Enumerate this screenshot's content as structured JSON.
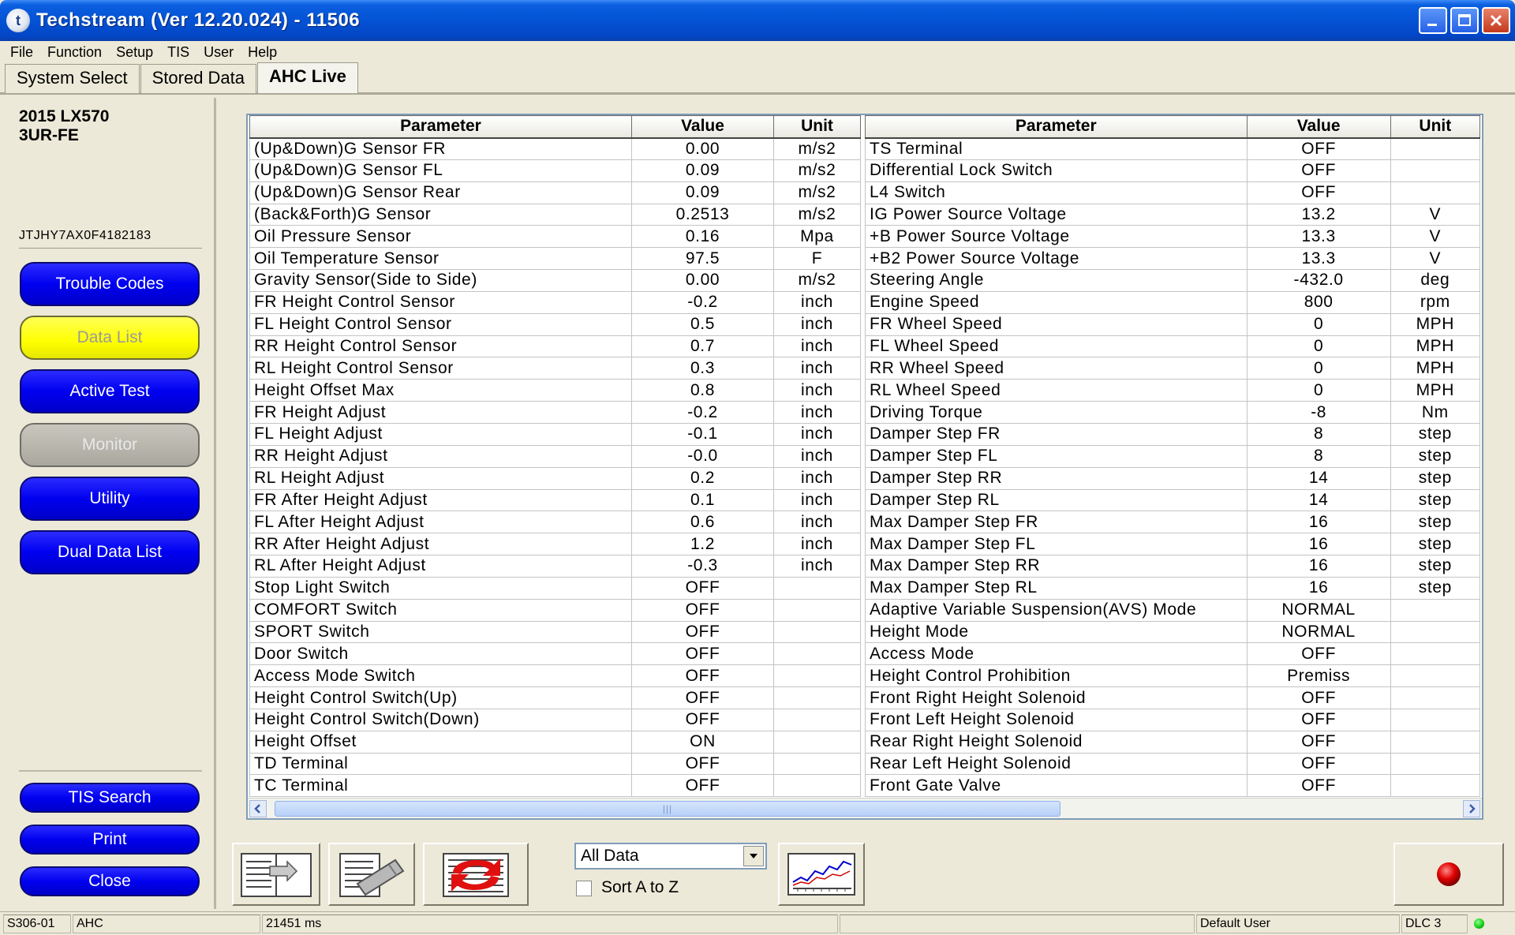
{
  "window": {
    "title": "Techstream (Ver 12.20.024) - 11506"
  },
  "menu": [
    "File",
    "Function",
    "Setup",
    "TIS",
    "User",
    "Help"
  ],
  "tabs": [
    "System Select",
    "Stored Data",
    "AHC Live"
  ],
  "vehicle": {
    "model": "2015 LX570",
    "engine": "3UR-FE",
    "vin": "JTJHY7AX0F4182183"
  },
  "nav": {
    "trouble_codes": "Trouble Codes",
    "data_list": "Data List",
    "active_test": "Active Test",
    "monitor": "Monitor",
    "utility": "Utility",
    "dual_data_list": "Dual Data List",
    "tis_search": "TIS Search",
    "print": "Print",
    "close": "Close"
  },
  "table": {
    "headers": [
      "Parameter",
      "Value",
      "Unit"
    ],
    "left_rows": [
      [
        "(Up&Down)G Sensor FR",
        "0.00",
        "m/s2"
      ],
      [
        "(Up&Down)G Sensor FL",
        "0.09",
        "m/s2"
      ],
      [
        "(Up&Down)G Sensor Rear",
        "0.09",
        "m/s2"
      ],
      [
        "(Back&Forth)G Sensor",
        "0.2513",
        "m/s2"
      ],
      [
        "Oil Pressure Sensor",
        "0.16",
        "Mpa"
      ],
      [
        "Oil Temperature Sensor",
        "97.5",
        "F"
      ],
      [
        "Gravity Sensor(Side to Side)",
        "0.00",
        "m/s2"
      ],
      [
        "FR Height Control Sensor",
        "-0.2",
        "inch"
      ],
      [
        "FL Height Control Sensor",
        "0.5",
        "inch"
      ],
      [
        "RR Height Control Sensor",
        "0.7",
        "inch"
      ],
      [
        "RL Height Control Sensor",
        "0.3",
        "inch"
      ],
      [
        "Height Offset Max",
        "0.8",
        "inch"
      ],
      [
        "FR Height Adjust",
        "-0.2",
        "inch"
      ],
      [
        "FL Height Adjust",
        "-0.1",
        "inch"
      ],
      [
        "RR Height Adjust",
        "-0.0",
        "inch"
      ],
      [
        "RL Height Adjust",
        "0.2",
        "inch"
      ],
      [
        "FR After Height Adjust",
        "0.1",
        "inch"
      ],
      [
        "FL After Height Adjust",
        "0.6",
        "inch"
      ],
      [
        "RR After Height Adjust",
        "1.2",
        "inch"
      ],
      [
        "RL After Height Adjust",
        "-0.3",
        "inch"
      ],
      [
        "Stop Light Switch",
        "OFF",
        ""
      ],
      [
        "COMFORT Switch",
        "OFF",
        ""
      ],
      [
        "SPORT Switch",
        "OFF",
        ""
      ],
      [
        "Door Switch",
        "OFF",
        ""
      ],
      [
        "Access Mode Switch",
        "OFF",
        ""
      ],
      [
        "Height Control Switch(Up)",
        "OFF",
        ""
      ],
      [
        "Height Control Switch(Down)",
        "OFF",
        ""
      ],
      [
        "Height Offset",
        "ON",
        ""
      ],
      [
        "TD Terminal",
        "OFF",
        ""
      ],
      [
        "TC Terminal",
        "OFF",
        ""
      ]
    ],
    "right_rows": [
      [
        "TS Terminal",
        "OFF",
        ""
      ],
      [
        "Differential Lock Switch",
        "OFF",
        ""
      ],
      [
        "L4 Switch",
        "OFF",
        ""
      ],
      [
        "IG Power Source Voltage",
        "13.2",
        "V"
      ],
      [
        "+B Power Source Voltage",
        "13.3",
        "V"
      ],
      [
        "+B2 Power Source Voltage",
        "13.3",
        "V"
      ],
      [
        "Steering Angle",
        "-432.0",
        "deg"
      ],
      [
        "Engine Speed",
        "800",
        "rpm"
      ],
      [
        "FR Wheel Speed",
        "0",
        "MPH"
      ],
      [
        "FL Wheel Speed",
        "0",
        "MPH"
      ],
      [
        "RR Wheel Speed",
        "0",
        "MPH"
      ],
      [
        "RL Wheel Speed",
        "0",
        "MPH"
      ],
      [
        "Driving Torque",
        "-8",
        "Nm"
      ],
      [
        "Damper Step FR",
        "8",
        "step"
      ],
      [
        "Damper Step FL",
        "8",
        "step"
      ],
      [
        "Damper Step RR",
        "14",
        "step"
      ],
      [
        "Damper Step RL",
        "14",
        "step"
      ],
      [
        "Max Damper Step FR",
        "16",
        "step"
      ],
      [
        "Max Damper Step FL",
        "16",
        "step"
      ],
      [
        "Max Damper Step RR",
        "16",
        "step"
      ],
      [
        "Max Damper Step RL",
        "16",
        "step"
      ],
      [
        "Adaptive Variable Suspension(AVS) Mode",
        "NORMAL",
        ""
      ],
      [
        "Height Mode",
        "NORMAL",
        ""
      ],
      [
        "Access Mode",
        "OFF",
        ""
      ],
      [
        "Height Control Prohibition",
        "Premiss",
        ""
      ],
      [
        "Front Right Height Solenoid",
        "OFF",
        ""
      ],
      [
        "Front Left Height Solenoid",
        "OFF",
        ""
      ],
      [
        "Rear Right Height Solenoid",
        "OFF",
        ""
      ],
      [
        "Rear Left Height Solenoid",
        "OFF",
        ""
      ],
      [
        "Front Gate Valve",
        "OFF",
        ""
      ]
    ]
  },
  "toolbar": {
    "data_filter": "All Data",
    "sort_label": "Sort A to Z",
    "sort_checked": false
  },
  "status": {
    "code": "S306-01",
    "system": "AHC",
    "time": "21451 ms",
    "user": "Default User",
    "connection": "DLC 3"
  },
  "colors": {
    "nav_blue": "#0000f0",
    "nav_active_yellow": "#ffff00",
    "nav_disabled": "#a9a79e",
    "record_red": "#e00000",
    "link_led": "#10c810"
  }
}
